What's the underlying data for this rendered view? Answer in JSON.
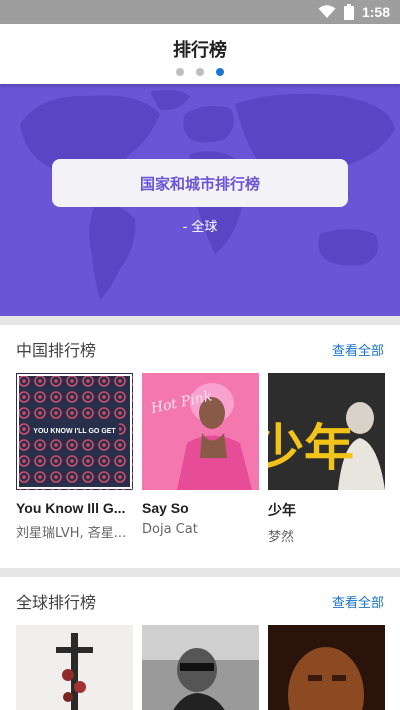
{
  "status_bar": {
    "time": "1:58"
  },
  "header": {
    "title": "排行榜",
    "page_dots": 3,
    "active_dot": 3
  },
  "banner": {
    "button_label": "国家和城市排行榜",
    "subtitle": "- 全球",
    "color": "#6a55d6"
  },
  "sections": [
    {
      "title": "中国排行榜",
      "link": "查看全部",
      "items": [
        {
          "title": "You Know Ill G...",
          "subtitle": "刘星瑞LVH, 吝星...",
          "cover_text": "YOU KNOW I'LL GO GET"
        },
        {
          "title": "Say So",
          "subtitle": "Doja Cat",
          "cover_text": "Hot Pink"
        },
        {
          "title": "少年",
          "subtitle": "梦然",
          "cover_text": "少年"
        }
      ]
    },
    {
      "title": "全球排行榜",
      "link": "查看全部",
      "items": []
    }
  ]
}
